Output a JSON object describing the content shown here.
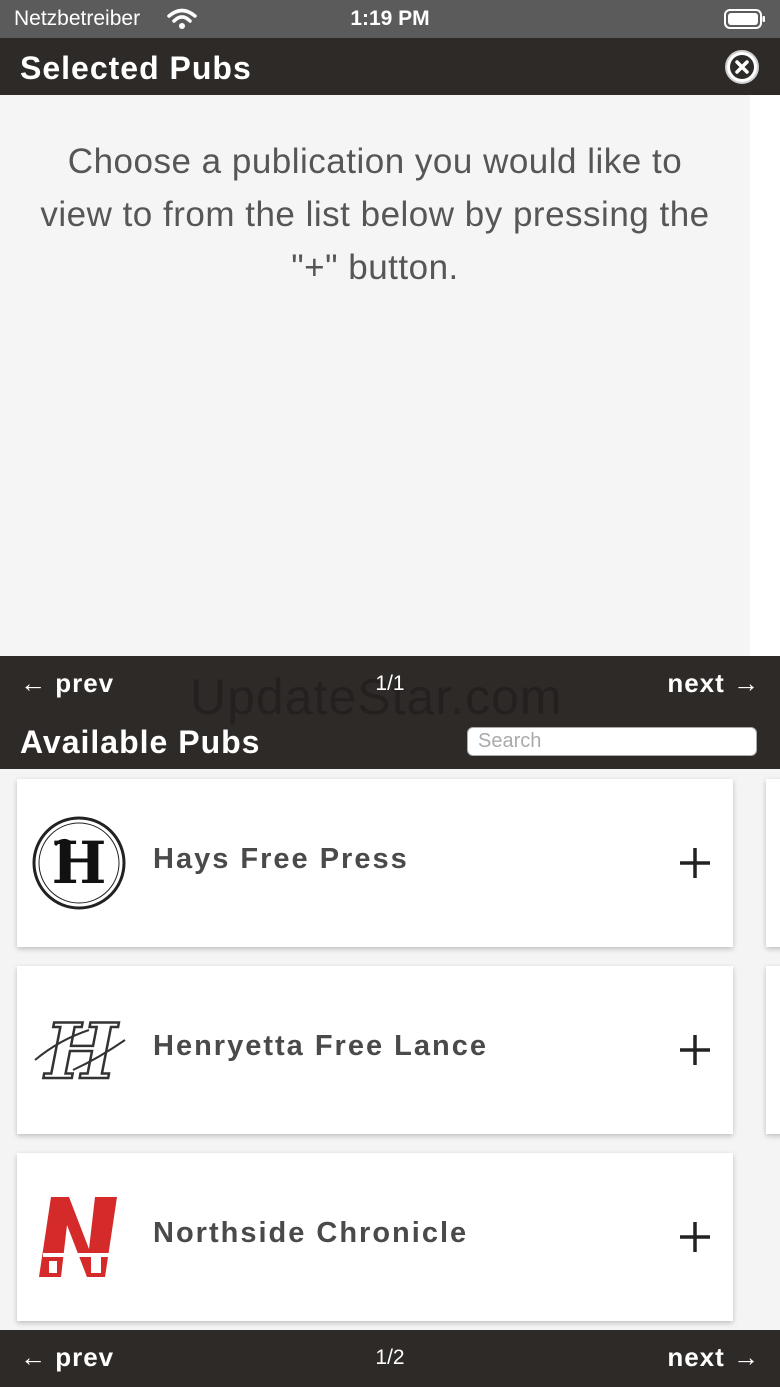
{
  "status_bar": {
    "carrier": "Netzbetreiber",
    "time": "1:19 PM"
  },
  "selected_pubs": {
    "title": "Selected Pubs",
    "hint": "Choose a publication you would like to view to from the list below by pressing the \"+\" button."
  },
  "available_pubs": {
    "prev_label": "← prev",
    "next_label": "next →",
    "page": "1/1",
    "watermark": "UpdateStar.com",
    "title": "Available Pubs",
    "search_placeholder": "Search"
  },
  "publications": [
    {
      "name": "Hays Free Press",
      "logo": "hays-free-press-logo-icon",
      "add_icon": "plus-icon"
    },
    {
      "name": "Henryetta Free Lance",
      "logo": "henryetta-free-lance-logo-icon",
      "add_icon": "plus-icon"
    },
    {
      "name": "Northside Chronicle",
      "logo": "northside-chronicle-logo-icon",
      "add_icon": "plus-icon"
    }
  ],
  "bottom_pager": {
    "prev_label": "← prev",
    "next_label": "next →",
    "page": "1/2"
  },
  "colors": {
    "header_bg": "#2e2a28",
    "status_bg": "#5b5b5b",
    "panel_bg": "#f5f5f5",
    "text_gray": "#4a4a4a",
    "northside_red": "#d42a2a"
  }
}
